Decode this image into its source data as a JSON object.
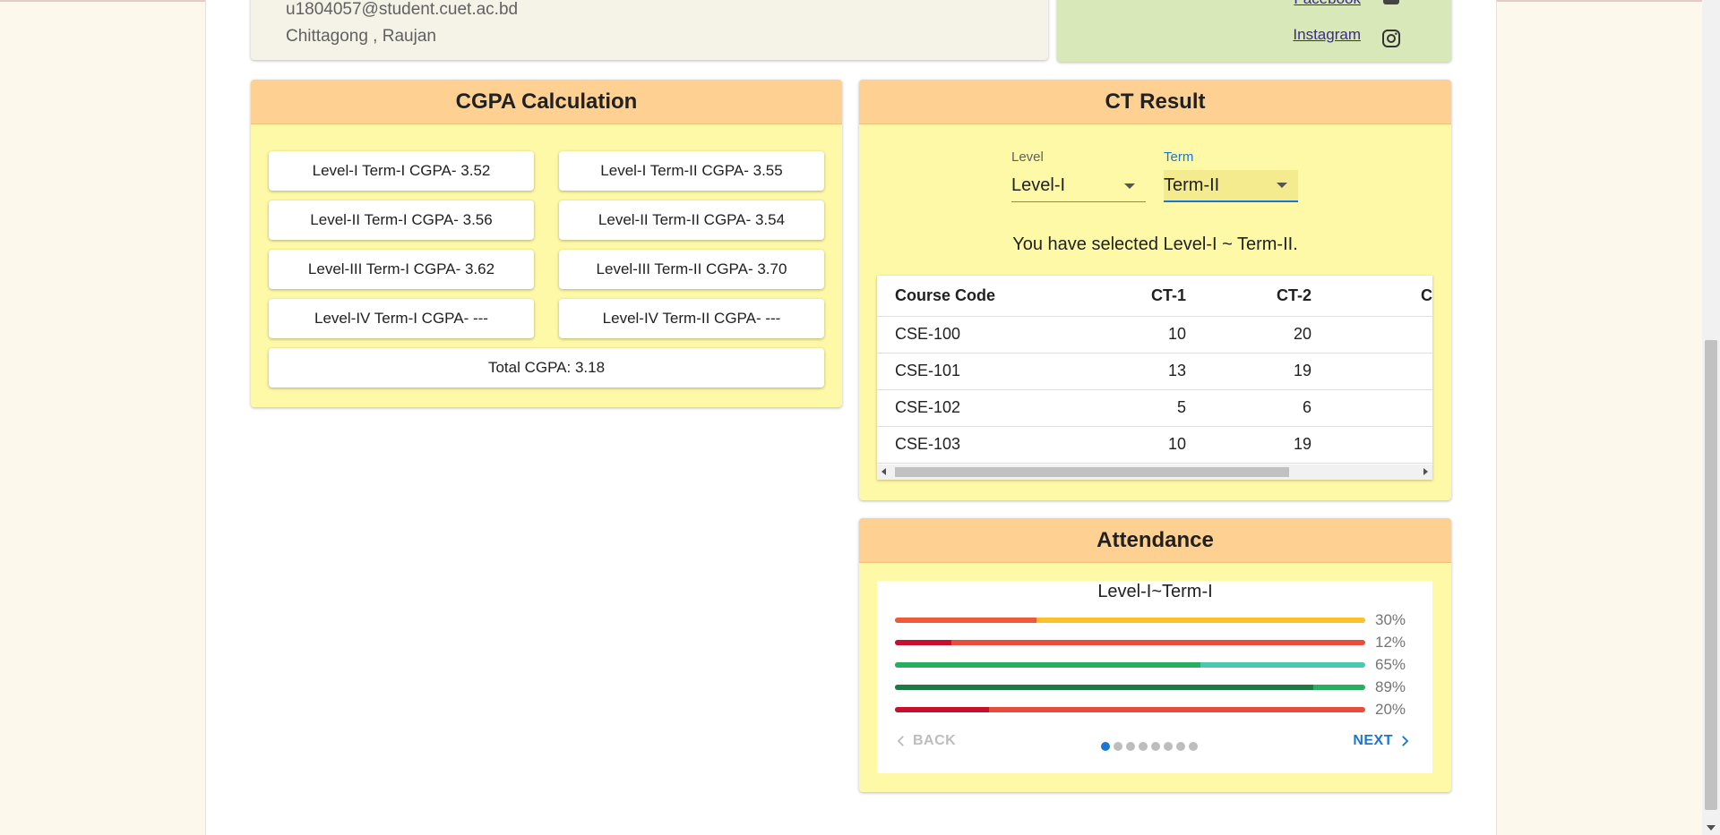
{
  "profile": {
    "email": "u1804057@student.cuet.ac.bd",
    "location": "Chittagong , Raujan"
  },
  "social": {
    "facebook": "Facebook",
    "instagram": "Instagram"
  },
  "cgpa": {
    "title": "CGPA Calculation",
    "items": [
      "Level-I Term-I CGPA- 3.52",
      "Level-I Term-II CGPA- 3.55",
      "Level-II Term-I CGPA- 3.56",
      "Level-II Term-II CGPA- 3.54",
      "Level-III Term-I CGPA- 3.62",
      "Level-III Term-II CGPA- 3.70",
      "Level-IV Term-I CGPA- ---",
      "Level-IV Term-II CGPA- ---"
    ],
    "total": "Total CGPA: 3.18"
  },
  "ct": {
    "title": "CT Result",
    "level_label": "Level",
    "level_value": "Level-I",
    "term_label": "Term",
    "term_value": "Term-II",
    "selected_message": "You have selected Level-I ~ Term-II.",
    "columns": [
      "Course Code",
      "CT-1",
      "CT-2",
      "C"
    ],
    "rows": [
      [
        "CSE-100",
        "10",
        "20"
      ],
      [
        "CSE-101",
        "13",
        "19"
      ],
      [
        "CSE-102",
        "5",
        "6"
      ],
      [
        "CSE-103",
        "10",
        "19"
      ]
    ]
  },
  "attendance": {
    "title": "Attendance",
    "subtitle": "Level-I~Term-I",
    "bars": [
      {
        "percent": 30,
        "label": "30%",
        "fill": "#ef5a3c",
        "track": "#fbc02d"
      },
      {
        "percent": 12,
        "label": "12%",
        "fill": "#c8102e",
        "track": "#e74c3c"
      },
      {
        "percent": 65,
        "label": "65%",
        "fill": "#27ae60",
        "track": "#48c9b0"
      },
      {
        "percent": 89,
        "label": "89%",
        "fill": "#1e7a44",
        "track": "#27ae60"
      },
      {
        "percent": 20,
        "label": "20%",
        "fill": "#c8102e",
        "track": "#e74c3c"
      }
    ],
    "back_label": "BACK",
    "next_label": "NEXT",
    "steps": 8,
    "active_step": 0
  },
  "colors": {
    "panel_header": "#fed193",
    "panel_body": "#fef9a6",
    "accent": "#1976d2"
  }
}
